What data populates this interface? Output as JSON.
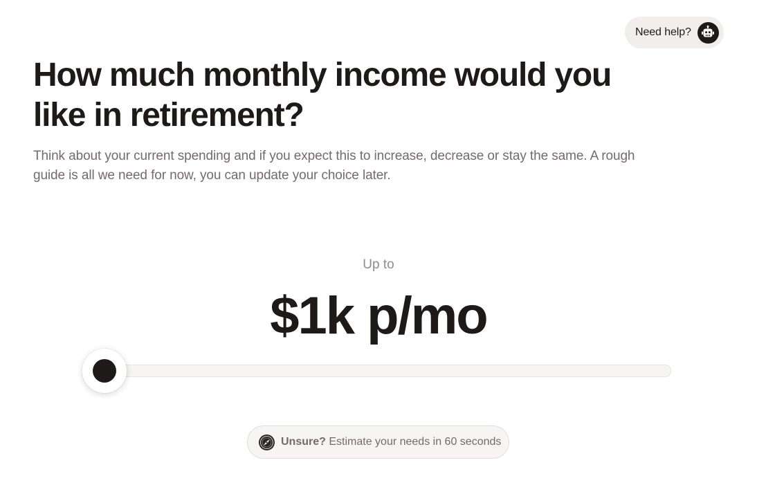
{
  "help": {
    "label": "Need help?",
    "icon": "robot-icon"
  },
  "question": {
    "title": "How much monthly income would you like in retirement?",
    "description": "Think about your current spending and if you expect this to increase, decrease or stay the same. A rough guide is all we need for now, you can update your choice later."
  },
  "income": {
    "prefix": "Up to",
    "amount": "$1k p/mo",
    "slider_fraction": 0
  },
  "unsure": {
    "icon": "compass-icon",
    "strong": "Unsure?",
    "text": " Estimate your needs in 60 seconds"
  },
  "colors": {
    "ink": "#1f1a1a",
    "muted": "#76696c",
    "pill_bg": "#f2eeec",
    "track_bg": "#f7f5f3"
  }
}
